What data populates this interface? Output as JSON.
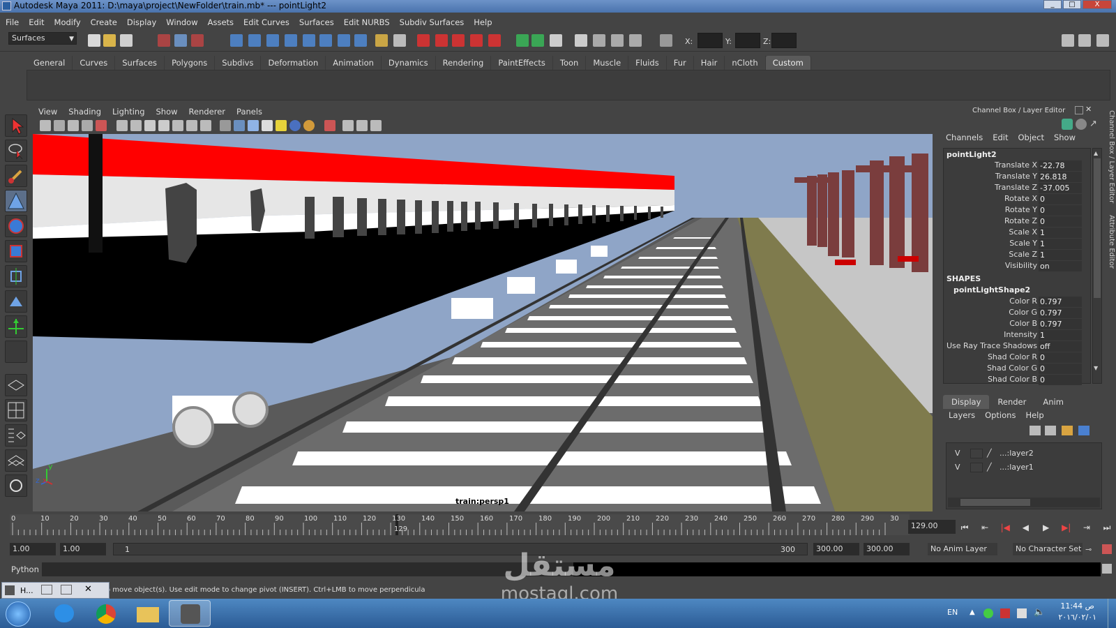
{
  "window": {
    "title": "Autodesk Maya 2011: D:\\maya\\project\\NewFolder\\train.mb*  ---  pointLight2",
    "minimize": "_",
    "maximize": "□",
    "close": "X"
  },
  "menubar": [
    "File",
    "Edit",
    "Modify",
    "Create",
    "Display",
    "Window",
    "Assets",
    "Edit Curves",
    "Surfaces",
    "Edit NURBS",
    "Subdiv Surfaces",
    "Help"
  ],
  "toolbar": {
    "mode": "Surfaces",
    "x_label": "X:",
    "y_label": "Y:",
    "z_label": "Z:"
  },
  "shelf": {
    "tabs": [
      "General",
      "Curves",
      "Surfaces",
      "Polygons",
      "Subdivs",
      "Deformation",
      "Animation",
      "Dynamics",
      "Rendering",
      "PaintEffects",
      "Toon",
      "Muscle",
      "Fluids",
      "Fur",
      "Hair",
      "nCloth",
      "Custom"
    ],
    "active_tab": "Custom"
  },
  "viewport": {
    "menu": [
      "View",
      "Shading",
      "Lighting",
      "Show",
      "Renderer",
      "Panels"
    ],
    "camera_label": "train:persp1",
    "axis_y": "y",
    "axis_z": "z",
    "axis_x": "x"
  },
  "channel_box": {
    "header": "Channel Box / Layer Editor",
    "menu": [
      "Channels",
      "Edit",
      "Object",
      "Show"
    ],
    "node": "pointLight2",
    "attributes": [
      {
        "label": "Translate X",
        "value": "-22.78"
      },
      {
        "label": "Translate Y",
        "value": "26.818"
      },
      {
        "label": "Translate Z",
        "value": "-37.005"
      },
      {
        "label": "Rotate X",
        "value": "0"
      },
      {
        "label": "Rotate Y",
        "value": "0"
      },
      {
        "label": "Rotate Z",
        "value": "0"
      },
      {
        "label": "Scale X",
        "value": "1"
      },
      {
        "label": "Scale Y",
        "value": "1"
      },
      {
        "label": "Scale Z",
        "value": "1"
      },
      {
        "label": "Visibility",
        "value": "on"
      }
    ],
    "shapes_label": "SHAPES",
    "shape_node": "pointLightShape2",
    "shape_attributes": [
      {
        "label": "Color R",
        "value": "0.797"
      },
      {
        "label": "Color G",
        "value": "0.797"
      },
      {
        "label": "Color B",
        "value": "0.797"
      },
      {
        "label": "Intensity",
        "value": "1"
      },
      {
        "label": "Use Ray Trace Shadows",
        "value": "off"
      },
      {
        "label": "Shad Color R",
        "value": "0"
      },
      {
        "label": "Shad Color G",
        "value": "0"
      },
      {
        "label": "Shad Color B",
        "value": "0"
      }
    ],
    "side_tabs": [
      "Channel Box / Layer Editor",
      "Attribute Editor"
    ]
  },
  "layer_editor": {
    "tabs": [
      "Display",
      "Render",
      "Anim"
    ],
    "active_tab": "Display",
    "menu": [
      "Layers",
      "Options",
      "Help"
    ],
    "layers": [
      {
        "visible": "V",
        "name": "...:layer2"
      },
      {
        "visible": "V",
        "name": "...:layer1"
      }
    ]
  },
  "timeline": {
    "ticks": [
      "0",
      "10",
      "20",
      "30",
      "40",
      "50",
      "60",
      "70",
      "80",
      "90",
      "100",
      "110",
      "120",
      "130",
      "140",
      "150",
      "160",
      "170",
      "180",
      "190",
      "200",
      "210",
      "220",
      "230",
      "240",
      "250",
      "260",
      "270",
      "280",
      "290",
      "30"
    ],
    "current_frame_marker": "129",
    "current_frame_field": "129.00"
  },
  "range": {
    "start": "1.00",
    "start_inner": "1.00",
    "slider_start": "1",
    "slider_end": "300",
    "end_inner": "300.00",
    "end": "300.00",
    "anim_layer": "No Anim Layer",
    "character_set": "No Character Set"
  },
  "command_line": {
    "language": "Python"
  },
  "help_line": {
    "text": "o move object(s). Use edit mode to change pivot (INSERT).  Ctrl+LMB to move perpendicula",
    "minimized_window": "H..."
  },
  "taskbar": {
    "language": "EN",
    "time": "11:44 ص",
    "date": "٢٠١٦/٠٢/٠١"
  },
  "watermark": {
    "arabic": "مستقل",
    "latin": "mostaql.com"
  },
  "colors": {
    "train_red": "#ff0000",
    "sky": "#8fa5c7",
    "grass": "#7f7b4d",
    "pillar": "#7a3d3d"
  }
}
